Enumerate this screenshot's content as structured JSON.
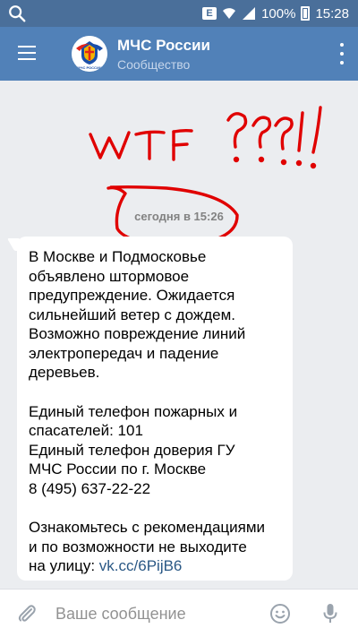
{
  "status_bar": {
    "battery_text": "100%",
    "time": "15:28",
    "network_badge": "E"
  },
  "header": {
    "title": "МЧС России",
    "subtitle": "Сообщество",
    "avatar_caption": "МЧС РОССИИ"
  },
  "annotation": {
    "text": "WTF ???!!",
    "color": "#e00000"
  },
  "conversation": {
    "timestamp": "сегодня в 15:26",
    "message_blocks": [
      {
        "lines": [
          "В Москве и Подмосковье",
          "объявлено штормовое",
          "предупреждение. Ожидается",
          "сильнейший ветер с дождем.",
          "Возможно повреждение линий",
          "электропередач и падение",
          "деревьев."
        ]
      },
      {
        "lines": [
          "Единый телефон пожарных и",
          "спасателей: 101",
          "Единый телефон доверия ГУ",
          "МЧС России по г. Москве",
          "8 (495) 637-22-22"
        ]
      },
      {
        "lines": [
          "Ознакомьтесь с рекомендациями",
          "и по возможности не выходите"
        ],
        "last_line_prefix": "на улицу: ",
        "link_text": "vk.cc/6PijB6"
      }
    ]
  },
  "input_bar": {
    "placeholder": "Ваше сообщение"
  },
  "colors": {
    "header_bg": "#5181b8",
    "status_bg": "#4a6f9a",
    "link": "#2a5885",
    "chat_bg": "#ebedf0"
  }
}
